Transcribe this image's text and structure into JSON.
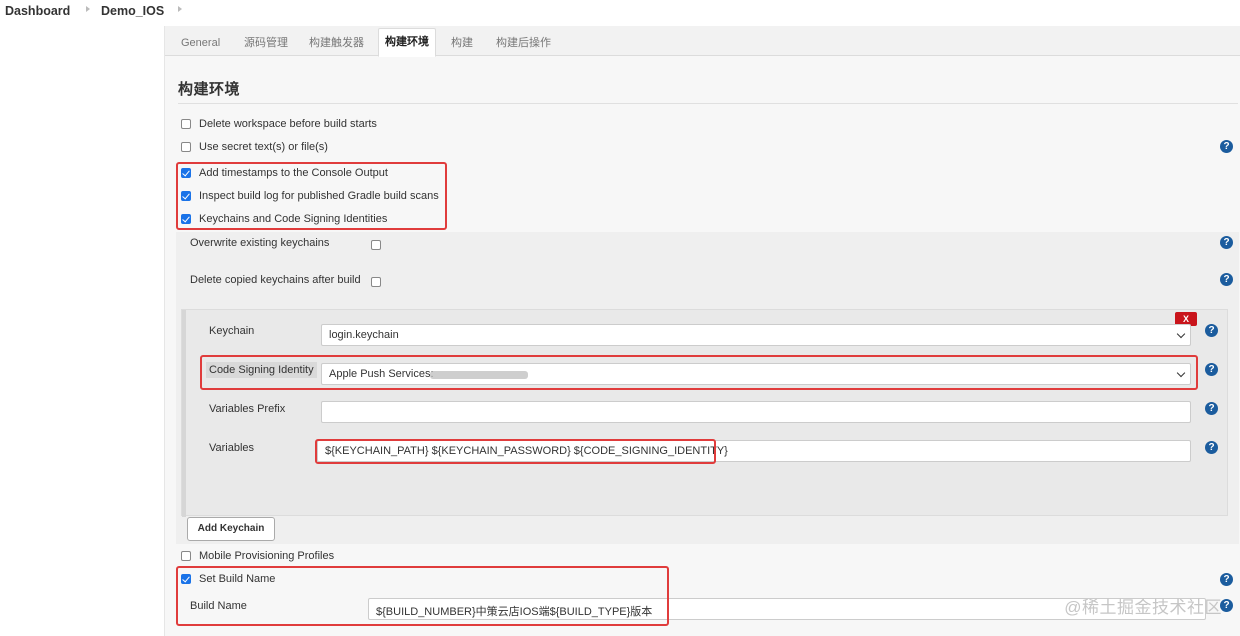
{
  "breadcrumb": [
    {
      "label": "Dashboard"
    },
    {
      "label": "Demo_IOS"
    }
  ],
  "tabs": [
    {
      "label": "General",
      "active": false
    },
    {
      "label": "源码管理",
      "active": false
    },
    {
      "label": "构建触发器",
      "active": false
    },
    {
      "label": "构建环境",
      "active": true
    },
    {
      "label": "构建",
      "active": false
    },
    {
      "label": "构建后操作",
      "active": false
    }
  ],
  "section_title": "构建环境",
  "options": [
    {
      "label": "Delete workspace before build starts",
      "checked": false
    },
    {
      "label": "Use secret text(s) or file(s)",
      "checked": false
    },
    {
      "label": "Add timestamps to the Console Output",
      "checked": true
    },
    {
      "label": "Inspect build log for published Gradle build scans",
      "checked": true
    },
    {
      "label": "Keychains and Code Signing Identities",
      "checked": true
    },
    {
      "label": "Mobile Provisioning Profiles",
      "checked": false
    },
    {
      "label": "Set Build Name",
      "checked": true
    }
  ],
  "keychains_section": {
    "overwrite_label": "Overwrite existing keychains",
    "overwrite_checked": false,
    "delete_label": "Delete copied keychains after build",
    "delete_checked": false,
    "delete_button": "X",
    "keychain_label": "Keychain",
    "keychain_value": "login.keychain",
    "signing_label": "Code Signing Identity",
    "signing_value": "Apple Push Services:",
    "prefix_label": "Variables Prefix",
    "prefix_value": "",
    "variables_label": "Variables",
    "variables_value": "${KEYCHAIN_PATH} ${KEYCHAIN_PASSWORD} ${CODE_SIGNING_IDENTITY}",
    "add_button": "Add Keychain"
  },
  "build_name": {
    "label": "Build Name",
    "value": "${BUILD_NUMBER}中策云店IOS端${BUILD_TYPE}版本"
  },
  "help_glyph": "?",
  "watermark": "@稀土掘金技术社区",
  "colors": {
    "highlight": "#e03c3c",
    "help": "#1b5c9e",
    "checkbox": "#1a73e8",
    "delete": "#c9141b"
  }
}
